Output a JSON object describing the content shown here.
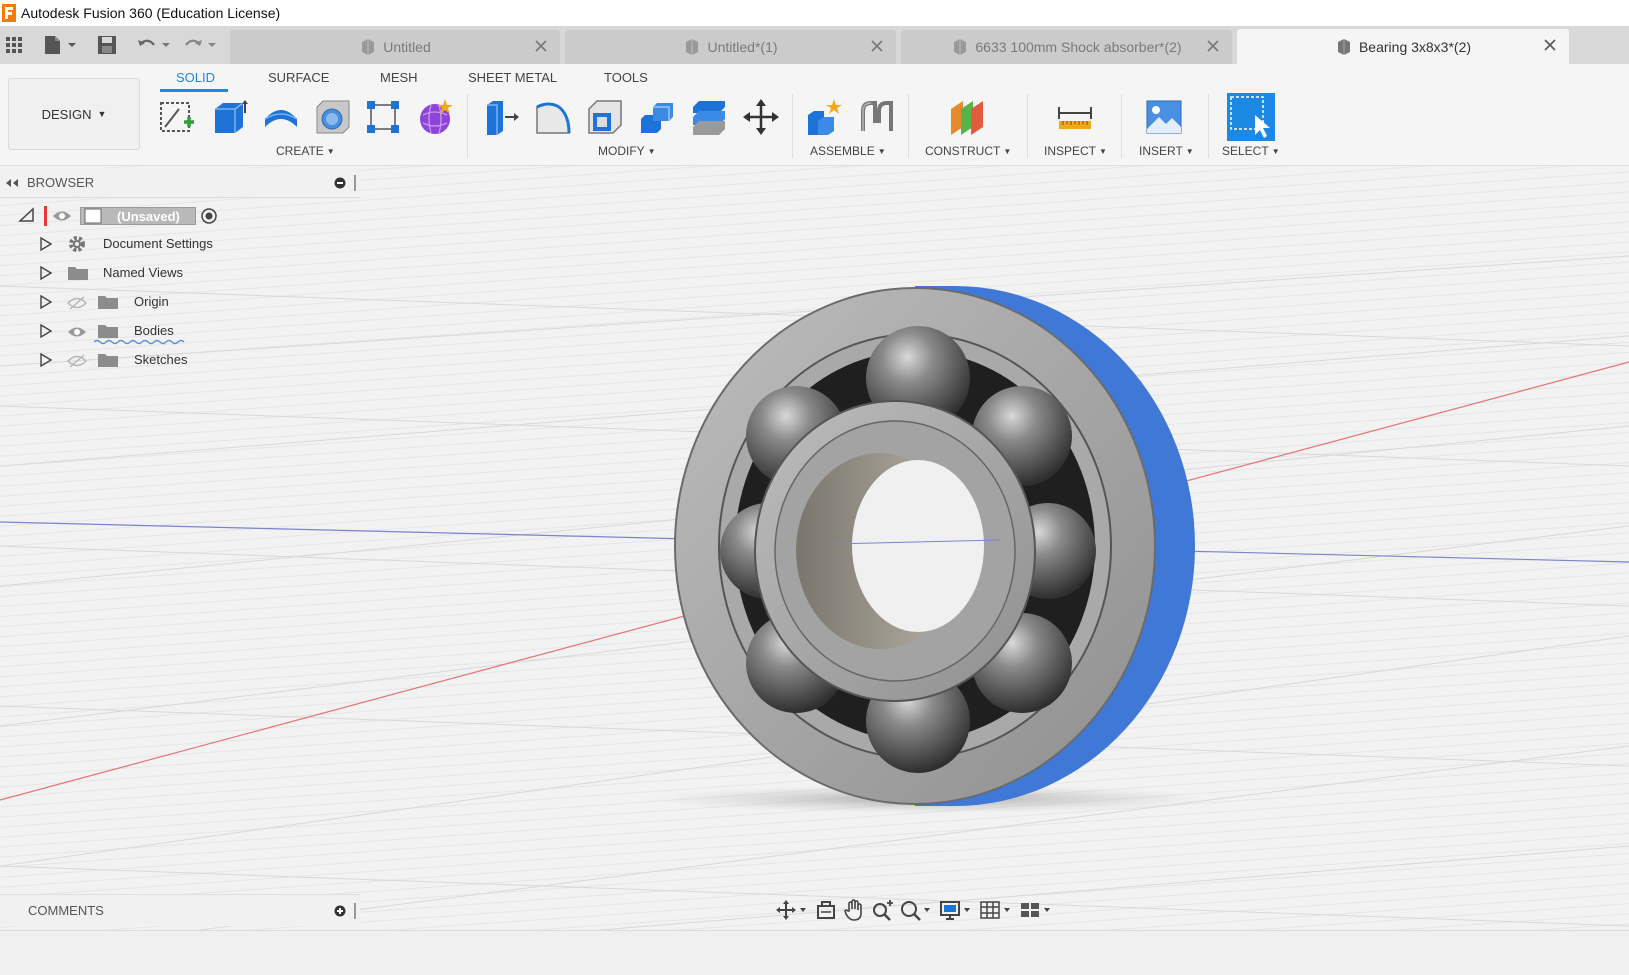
{
  "window": {
    "title": "Autodesk Fusion 360 (Education License)"
  },
  "tabs": [
    {
      "label": "Untitled",
      "active": false
    },
    {
      "label": "Untitled*(1)",
      "active": false
    },
    {
      "label": "6633 100mm Shock absorber*(2)",
      "active": false
    },
    {
      "label": "Bearing 3x8x3*(2)",
      "active": true
    }
  ],
  "toolbar": {
    "workspace_label": "DESIGN",
    "workspace_tabs": [
      "SOLID",
      "SURFACE",
      "MESH",
      "SHEET METAL",
      "TOOLS"
    ],
    "active_workspace_tab": "SOLID",
    "groups": {
      "create": "CREATE",
      "modify": "MODIFY",
      "assemble": "ASSEMBLE",
      "construct": "CONSTRUCT",
      "inspect": "INSPECT",
      "insert": "INSERT",
      "select": "SELECT"
    }
  },
  "browser": {
    "header": "BROWSER",
    "root": "(Unsaved)",
    "items": [
      "Document Settings",
      "Named Views",
      "Origin",
      "Bodies",
      "Sketches"
    ]
  },
  "comments": {
    "header": "COMMENTS"
  },
  "colors": {
    "accent": "#1e88e5",
    "bearing_outer_side": "#3f78d6",
    "ball": "#6a6a6a",
    "axis_x": "#e57373",
    "axis_z": "#7986cb"
  }
}
